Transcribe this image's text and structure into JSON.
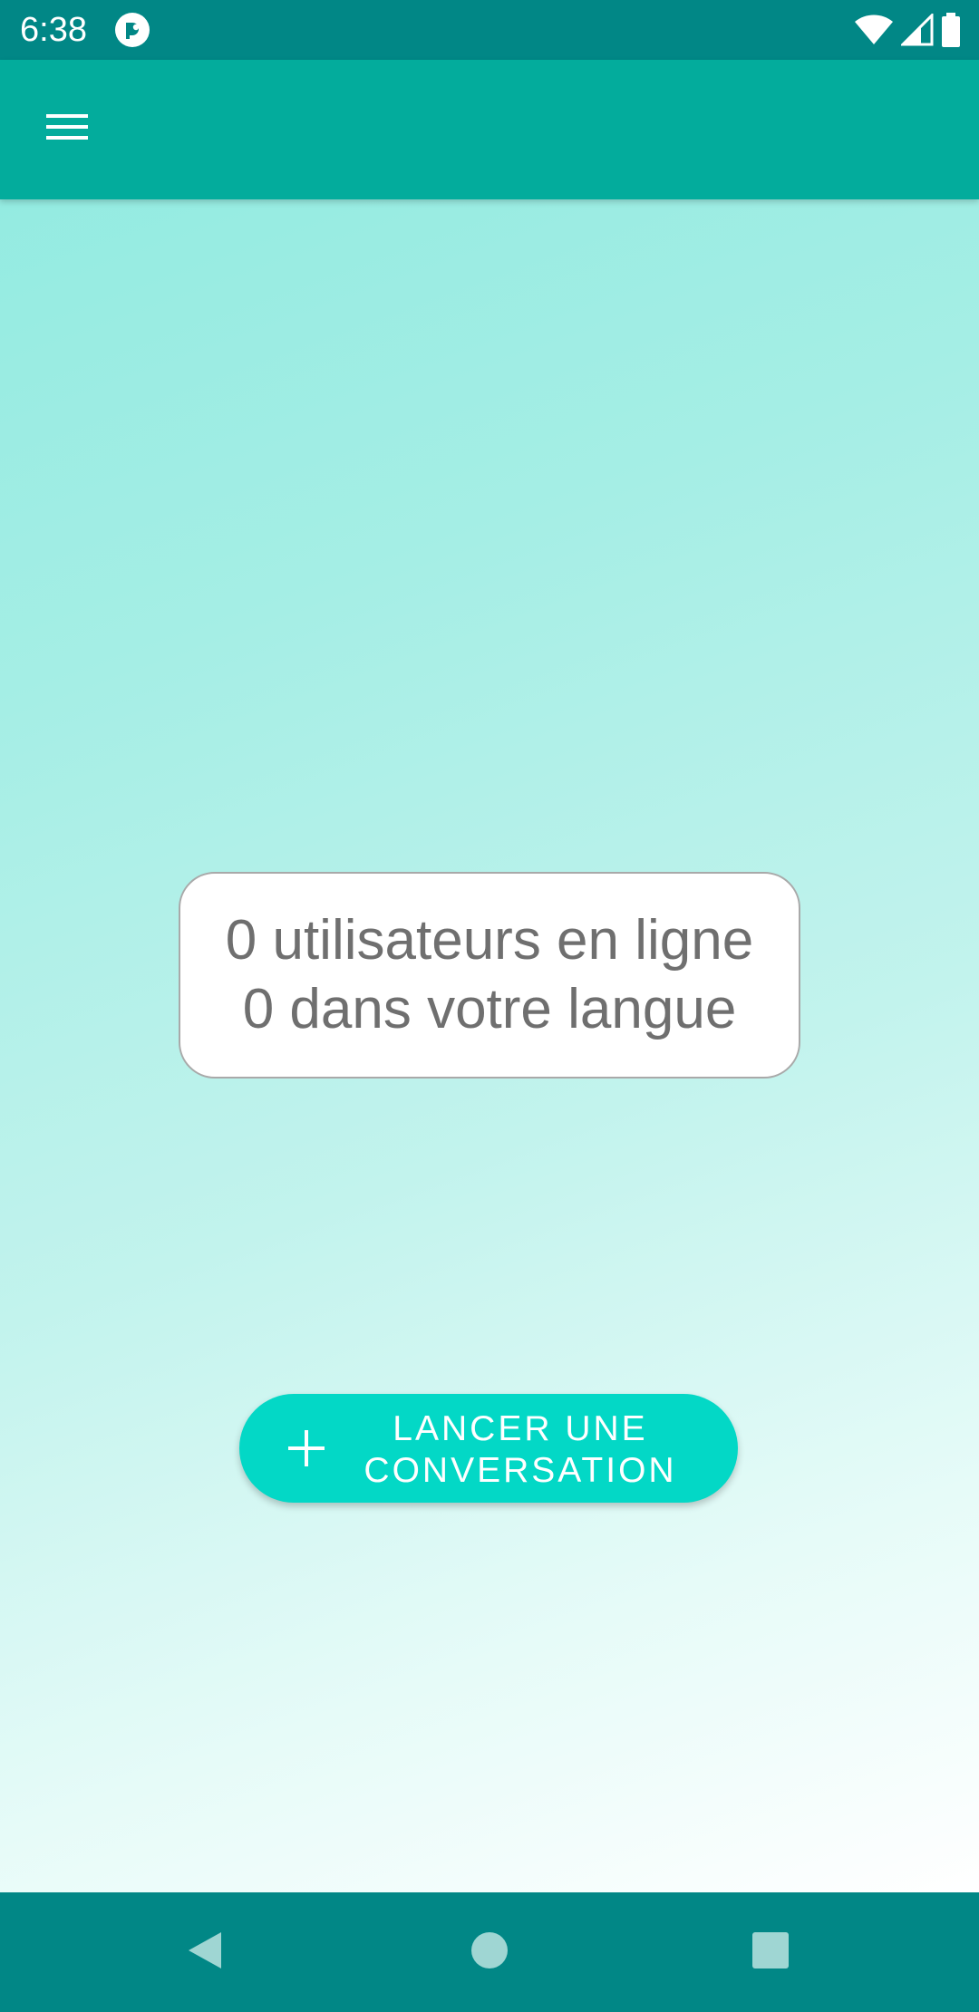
{
  "status_bar": {
    "time": "6:38",
    "icons": [
      "app-notification-icon",
      "wifi-icon",
      "cell-signal-icon",
      "battery-icon"
    ]
  },
  "app_bar": {
    "menu_icon": "menu-icon"
  },
  "stats": {
    "online_users": "0 utilisateurs en ligne",
    "same_language": "0 dans votre langue"
  },
  "start_button": {
    "icon": "plus-icon",
    "label_line1": "LANCER UNE",
    "label_line2": "CONVERSATION"
  },
  "nav_bar": {
    "icons": [
      "back-icon",
      "home-icon",
      "recents-icon"
    ]
  },
  "colors": {
    "status_bar": "#018786",
    "app_bar": "#03ac9c",
    "accent_button": "#03d8c6",
    "nav_bar": "#018786",
    "gradient_top": "#94ebe1",
    "gradient_bottom": "#ffffff",
    "stats_text": "#6f6f6f"
  }
}
